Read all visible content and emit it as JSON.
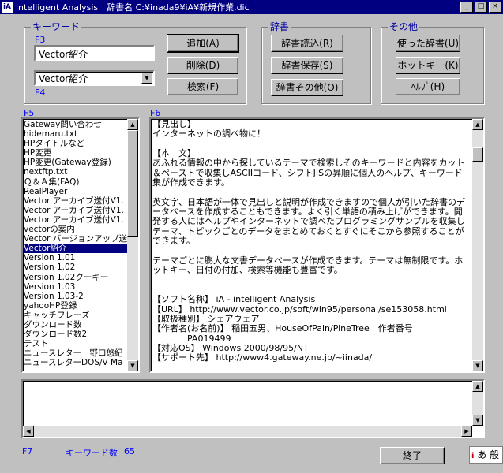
{
  "window": {
    "title": "intelligent Analysis　辞書名 C:¥inada9¥iA¥新規作業.dic",
    "minimize": "_",
    "maximize": "□",
    "close": "×"
  },
  "keyword_group": {
    "label": "キーワード",
    "f3": "F3",
    "f4": "F4",
    "input_value": "Vector紹介",
    "combo_value": "Vector紹介",
    "add": "追加(A)",
    "delete": "削除(D)",
    "search": "検索(F)"
  },
  "dict_group": {
    "label": "辞書",
    "load": "辞書読込(R)",
    "save": "辞書保存(S)",
    "other": "辞書その他(O)"
  },
  "other_group": {
    "label": "その他",
    "used": "使った辞書(U)",
    "hotkey": "ホットキー(K)",
    "help": "ﾍﾙﾌﾟ(H)"
  },
  "f5": "F5",
  "f6": "F6",
  "keyword_list": [
    "Gateway問い合わせ",
    "hidemaru.txt",
    "HPタイトルなど",
    "HP変更",
    "HP変更(Gateway登録)",
    "nextftp.txt",
    "Ｑ＆Ａ集(FAQ)",
    "RealPlayer",
    "Vector アーカイブ送付V1.",
    "Vector アーカイブ送付V1.",
    "Vector アーカイブ送付V1.",
    "vectorの案内",
    "Vector バージョンアップ送",
    "Vector紹介",
    "Version 1.01",
    "Version 1.02",
    "Version 1.02クーキー",
    "Version 1.03",
    "Version 1.03-2",
    "yahooHP登録",
    "キャッチフレーズ",
    "ダウンロード数",
    "ダウンロード数2",
    "テスト",
    "ニュースレター　野口悠紀",
    "ニュースレターDOS/V Ma"
  ],
  "selected_index": 13,
  "document_text": "【見出し】\nインターネットの調べ物に！\n\n【本　文】\nあふれる情報の中から探しているテーマで検索しそのキーワードと内容をカット＆ペーストで収集しASCIIコード、シフトJISの昇順に個人のヘルプ、キーワード集が作成できます。\n\n英文字、日本語が一体で見出しと説明が作成できますので個人が引いた辞書のデータベースを作成することもできます。よく引く単語の積み上げができます。開発する人にはヘルプやインターネットで調べたプログラミングサンプルを収集しテーマ、トピックごとのデータをまとめておくとすぐにそこから参照することができます。\n\nテーマごとに膨大な文書データベースが作成できます。テーマは無制限です。ホットキー、日付の付加、検索等機能も豊富です。\n\n\n【ソフト名称】 iA - intelligent Analysis\n【URL】 http://www.vector.co.jp/soft/win95/personal/se153058.html\n【取扱種別】 シェアウェア\n【作者名(お名前)】 稲田五男、HouseOfPain/PineTree　作者番号\n　　　　PA019499\n【対応OS】 Windows 2000/98/95/NT\n【サポート先】 http://www4.gateway.ne.jp/~iinada/",
  "lower_text": "",
  "status": {
    "f7": "F7",
    "keyword_count_label": "キーワード数",
    "keyword_count": "65"
  },
  "exit_button": "終了",
  "ime": {
    "icon": "i",
    "text": "あ 般"
  },
  "colors": {
    "title_bg": "#000080",
    "window_bg": "#c0c0c0",
    "label_blue": "#0000ff",
    "selection": "#000080"
  }
}
